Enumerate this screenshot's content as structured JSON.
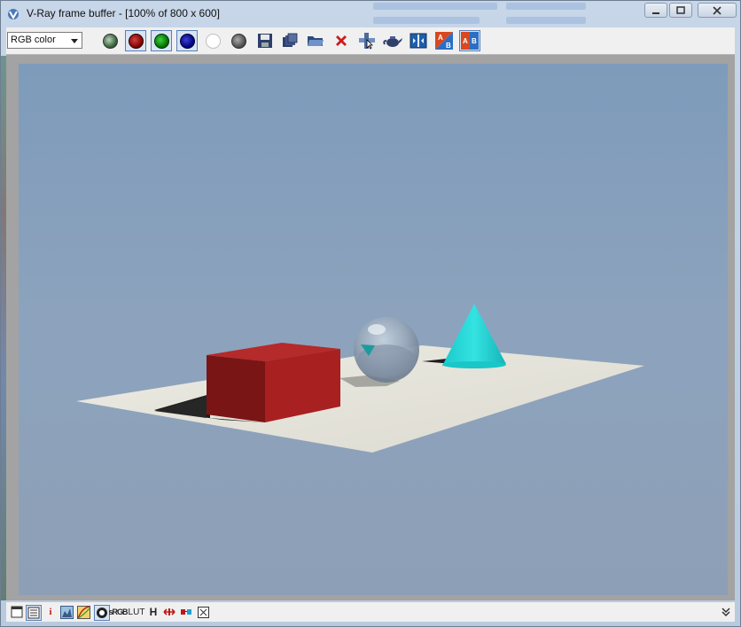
{
  "window": {
    "title": "V-Ray frame buffer - [100% of 800 x 600]"
  },
  "toolbar": {
    "channel_select": "RGB color",
    "buttons": [
      {
        "name": "rgb-channels-icon",
        "color": "#3a6a3a"
      },
      {
        "name": "red-channel-icon",
        "color": "#b00000"
      },
      {
        "name": "green-channel-icon",
        "color": "#00a000"
      },
      {
        "name": "blue-channel-icon",
        "color": "#0000a0"
      },
      {
        "name": "alpha-white-icon",
        "color": "#ffffff"
      },
      {
        "name": "monochrome-icon",
        "color": "#666666"
      }
    ]
  },
  "statusbar": {
    "info_label": "i",
    "srgb_label": "sRGB",
    "lut_label": "LUT",
    "h_label": "H"
  },
  "colors": {
    "sky_top": "#7e9bbb",
    "sky_bottom": "#8c9fb8",
    "plane": "#e6e4db",
    "box": "#b32323",
    "cone": "#20d6d6"
  }
}
